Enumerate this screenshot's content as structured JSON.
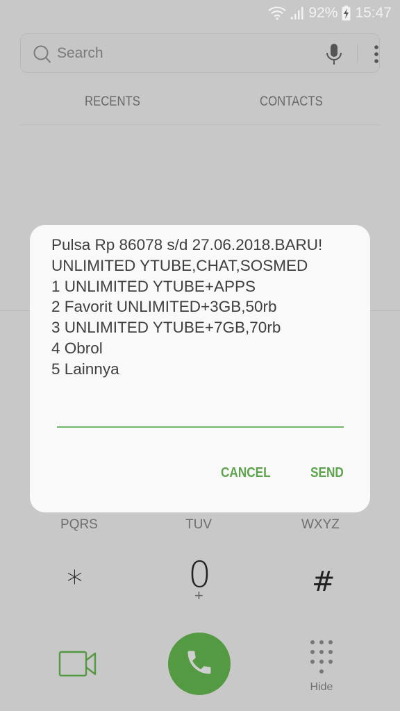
{
  "status_bar": {
    "wifi_icon": "wifi-icon",
    "signal_icon": "signal-icon",
    "battery_percent": "92%",
    "battery_icon": "battery-charging-icon",
    "time": "15:47"
  },
  "search": {
    "placeholder": "Search",
    "value": "",
    "icons": [
      "search-icon",
      "mic-icon",
      "more-vertical-icon"
    ]
  },
  "tabs": [
    {
      "label": "RECENTS"
    },
    {
      "label": "CONTACTS"
    }
  ],
  "dialpad": {
    "visible_row_letters": [
      "PQRS",
      "TUV",
      "WXYZ"
    ],
    "keys": [
      {
        "symbol": "*",
        "sub": ""
      },
      {
        "symbol": "0",
        "sub": "+"
      },
      {
        "symbol": "#",
        "sub": ""
      }
    ],
    "hide_label": "Hide"
  },
  "bottom_bar": {
    "video_call_icon": "video-call-icon",
    "call_icon": "phone-icon",
    "keypad_icon": "keypad-icon",
    "accent_color": "#549a42"
  },
  "dialog": {
    "message": "Pulsa Rp 86078 s/d 27.06.2018.BARU!\nUNLIMITED YTUBE,CHAT,SOSMED\n1 UNLIMITED YTUBE+APPS\n2 Favorit UNLIMITED+3GB,50rb\n3 UNLIMITED YTUBE+7GB,70rb\n4 Obrol\n5 Lainnya",
    "input_value": "",
    "cancel_label": "CANCEL",
    "send_label": "SEND",
    "accent_color": "#5ea34d"
  }
}
